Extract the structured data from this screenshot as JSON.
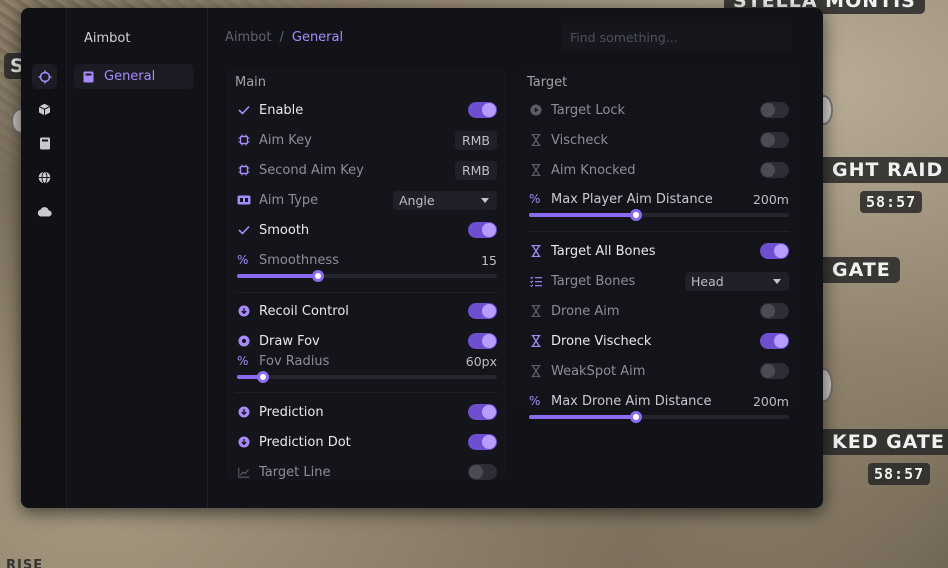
{
  "map": {
    "labels": [
      {
        "text": "STELLA MONTIS",
        "kind": "label"
      },
      {
        "text": "GHT RAID",
        "kind": "label"
      },
      {
        "text": "GATE",
        "kind": "label"
      },
      {
        "text": "KED GATE",
        "kind": "label"
      }
    ],
    "times": [
      "58:57",
      "58:57"
    ],
    "bits": [
      "S",
      "RISE"
    ]
  },
  "rail": {
    "icons": [
      "crosshair-icon",
      "cube-icon",
      "book-icon",
      "globe-icon",
      "cloud-icon"
    ]
  },
  "nav": {
    "title": "Aimbot",
    "item": "General"
  },
  "breadcrumb": {
    "root": "Aimbot",
    "separator": "/",
    "current": "General"
  },
  "search": {
    "placeholder": "Find something..."
  },
  "colors": {
    "accent": "#a78bfa",
    "toggle_on": "#6d4fd0",
    "panel_bg": "#121318"
  },
  "main": {
    "title": "Main",
    "enable": {
      "label": "Enable",
      "on": true
    },
    "aim_key": {
      "label": "Aim Key",
      "value": "RMB"
    },
    "second_aim_key": {
      "label": "Second Aim Key",
      "value": "RMB"
    },
    "aim_type": {
      "label": "Aim Type",
      "value": "Angle"
    },
    "smooth": {
      "label": "Smooth",
      "on": true
    },
    "smoothness": {
      "label": "Smoothness",
      "value": "15",
      "fraction": 0.31
    },
    "recoil_control": {
      "label": "Recoil Control",
      "on": true
    },
    "draw_fov": {
      "label": "Draw Fov",
      "on": true
    },
    "fov_radius": {
      "label": "Fov Radius",
      "value": "60px",
      "fraction": 0.1
    },
    "prediction": {
      "label": "Prediction",
      "on": true
    },
    "prediction_dot": {
      "label": "Prediction Dot",
      "on": true
    },
    "target_line": {
      "label": "Target Line",
      "on": false
    }
  },
  "target": {
    "title": "Target",
    "target_lock": {
      "label": "Target Lock",
      "on": false
    },
    "vischeck": {
      "label": "Vischeck",
      "on": false
    },
    "aim_knocked": {
      "label": "Aim Knocked",
      "on": false
    },
    "max_player_aim_distance": {
      "label": "Max Player Aim Distance",
      "value": "200m",
      "fraction": 0.41
    },
    "target_all_bones": {
      "label": "Target All Bones",
      "on": true
    },
    "target_bones": {
      "label": "Target Bones",
      "value": "Head"
    },
    "drone_aim": {
      "label": "Drone Aim",
      "on": false
    },
    "drone_vischeck": {
      "label": "Drone Vischeck",
      "on": true
    },
    "weakspot_aim": {
      "label": "WeakSpot Aim",
      "on": false
    },
    "max_drone_aim_distance": {
      "label": "Max Drone Aim Distance",
      "value": "200m",
      "fraction": 0.41
    }
  }
}
